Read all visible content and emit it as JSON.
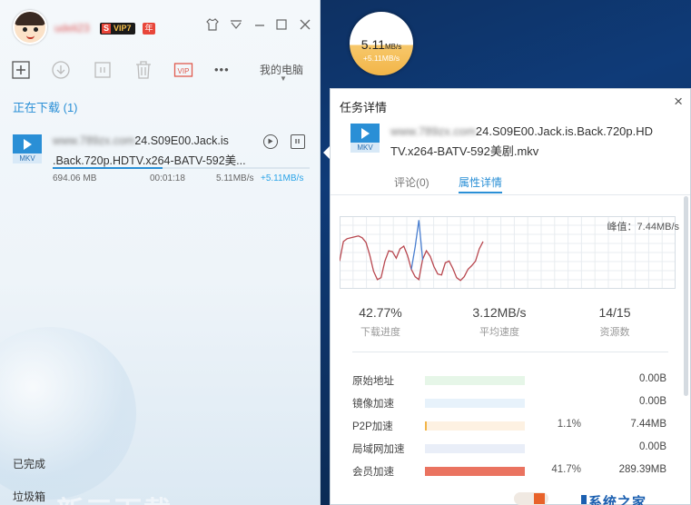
{
  "app": {
    "username": "udeli23",
    "vip_label": "VIP7",
    "year_label": "年"
  },
  "titlebar": {
    "icons": [
      "skin-icon",
      "menu-icon",
      "minimize-icon",
      "maximize-icon",
      "close-icon"
    ]
  },
  "toolbar": {
    "buttons": [
      "new-task",
      "download-start",
      "pause",
      "delete",
      "vip",
      "more"
    ],
    "vip_text": "VIP",
    "more_text": "•••",
    "location_label": "我的电脑"
  },
  "downloading": {
    "header": "正在下载 (1)",
    "item": {
      "type_label": "MKV",
      "name_hidden_part": "www.789zx.com",
      "name_line1": "24.S09E00.Jack.is",
      "name_line2": ".Back.720p.HDTV.x264-BATV-592美...",
      "size": "694.06 MB",
      "time_left": "00:01:18",
      "speed": "5.11MB/s",
      "boost": "+5.11MB/s",
      "progress": 0.4277
    }
  },
  "sidebar_bottom": {
    "completed": "已完成",
    "trash": "垃圾箱"
  },
  "speed_ball": {
    "value": "5.11",
    "unit": "MB/s",
    "boost": "+5.11MB/s"
  },
  "task_panel": {
    "title": "任务详情",
    "close_label": "×",
    "file": {
      "type_label": "MKV",
      "name_hidden_part": "www.789zx.com",
      "name_line1": "24.S09E00.Jack.is.Back.720p.HD",
      "name_line2": "TV.x264-BATV-592美剧.mkv"
    },
    "tabs": [
      {
        "label": "评论(0)",
        "active": false
      },
      {
        "label": "属性详情",
        "active": true
      }
    ],
    "peak_label": "峰值：7.44MB/s",
    "stats": [
      {
        "value": "42.77%",
        "label": "下载进度"
      },
      {
        "value": "3.12MB/s",
        "label": "平均速度"
      },
      {
        "value": "14/15",
        "label": "资源数"
      }
    ],
    "sources": [
      {
        "name": "原始地址",
        "percent": "",
        "amount": "0.00B",
        "color": "#e6f6e8",
        "fill_ratio": 0,
        "fill_color": "#8fd19e"
      },
      {
        "name": "镜像加速",
        "percent": "",
        "amount": "0.00B",
        "color": "#e7f2fb",
        "fill_ratio": 0,
        "fill_color": "#8cc4ec"
      },
      {
        "name": "P2P加速",
        "percent": "1.1%",
        "amount": "7.44MB",
        "color": "#fdf1e2",
        "fill_ratio": 0.02,
        "fill_color": "#f2b548"
      },
      {
        "name": "局域网加速",
        "percent": "",
        "amount": "0.00B",
        "color": "#e9eef8",
        "fill_ratio": 0,
        "fill_color": "#9fb2dc"
      },
      {
        "name": "会员加速",
        "percent": "41.7%",
        "amount": "289.39MB",
        "color": "#f6d6cf",
        "fill_ratio": 1,
        "fill_color": "#ea7360"
      }
    ]
  },
  "watermark": {
    "text": "系统之家"
  },
  "branding": {
    "text": "新三下载"
  },
  "chart_data": {
    "type": "line",
    "title": "",
    "peak_label": "峰值：7.44MB/s",
    "ylim": [
      0,
      7.44
    ],
    "series": [
      {
        "color": "#b8474f",
        "values": [
          3.0,
          5.1,
          5.4,
          5.5,
          5.6,
          5.7,
          5.5,
          5.0,
          3.6,
          1.9,
          1.0,
          1.2,
          3.0,
          4.1,
          4.0,
          3.3,
          4.3,
          4.6,
          3.6,
          2.1,
          1.3,
          1.0,
          3.2,
          4.1,
          3.5,
          2.4,
          1.6,
          1.5,
          2.8,
          3.0,
          2.2,
          1.2,
          0.9,
          1.3,
          2.1,
          2.5,
          3.0,
          4.3,
          5.1
        ]
      },
      {
        "color": "#4a7fd0",
        "values": [
          null,
          null,
          null,
          null,
          null,
          null,
          null,
          null,
          null,
          null,
          null,
          null,
          null,
          null,
          null,
          null,
          null,
          null,
          null,
          2.1,
          4.5,
          7.4,
          3.1,
          null,
          null,
          null,
          null,
          null,
          null,
          null,
          null,
          null,
          null,
          null,
          null,
          null,
          null,
          null,
          null
        ]
      }
    ]
  }
}
